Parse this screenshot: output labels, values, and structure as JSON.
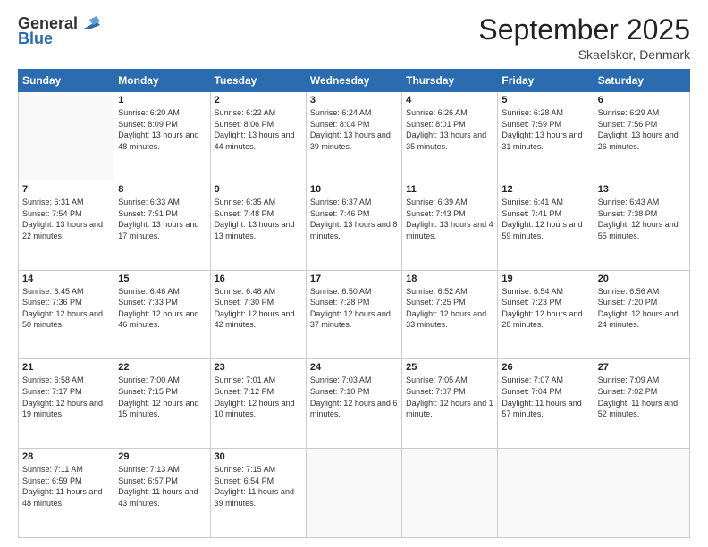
{
  "header": {
    "logo_line1": "General",
    "logo_line2": "Blue",
    "month": "September 2025",
    "location": "Skaelskor, Denmark"
  },
  "days_of_week": [
    "Sunday",
    "Monday",
    "Tuesday",
    "Wednesday",
    "Thursday",
    "Friday",
    "Saturday"
  ],
  "weeks": [
    [
      {
        "day": "",
        "sunrise": "",
        "sunset": "",
        "daylight": ""
      },
      {
        "day": "1",
        "sunrise": "6:20 AM",
        "sunset": "8:09 PM",
        "daylight": "13 hours and 48 minutes."
      },
      {
        "day": "2",
        "sunrise": "6:22 AM",
        "sunset": "8:06 PM",
        "daylight": "13 hours and 44 minutes."
      },
      {
        "day": "3",
        "sunrise": "6:24 AM",
        "sunset": "8:04 PM",
        "daylight": "13 hours and 39 minutes."
      },
      {
        "day": "4",
        "sunrise": "6:26 AM",
        "sunset": "8:01 PM",
        "daylight": "13 hours and 35 minutes."
      },
      {
        "day": "5",
        "sunrise": "6:28 AM",
        "sunset": "7:59 PM",
        "daylight": "13 hours and 31 minutes."
      },
      {
        "day": "6",
        "sunrise": "6:29 AM",
        "sunset": "7:56 PM",
        "daylight": "13 hours and 26 minutes."
      }
    ],
    [
      {
        "day": "7",
        "sunrise": "6:31 AM",
        "sunset": "7:54 PM",
        "daylight": "13 hours and 22 minutes."
      },
      {
        "day": "8",
        "sunrise": "6:33 AM",
        "sunset": "7:51 PM",
        "daylight": "13 hours and 17 minutes."
      },
      {
        "day": "9",
        "sunrise": "6:35 AM",
        "sunset": "7:48 PM",
        "daylight": "13 hours and 13 minutes."
      },
      {
        "day": "10",
        "sunrise": "6:37 AM",
        "sunset": "7:46 PM",
        "daylight": "13 hours and 8 minutes."
      },
      {
        "day": "11",
        "sunrise": "6:39 AM",
        "sunset": "7:43 PM",
        "daylight": "13 hours and 4 minutes."
      },
      {
        "day": "12",
        "sunrise": "6:41 AM",
        "sunset": "7:41 PM",
        "daylight": "12 hours and 59 minutes."
      },
      {
        "day": "13",
        "sunrise": "6:43 AM",
        "sunset": "7:38 PM",
        "daylight": "12 hours and 55 minutes."
      }
    ],
    [
      {
        "day": "14",
        "sunrise": "6:45 AM",
        "sunset": "7:36 PM",
        "daylight": "12 hours and 50 minutes."
      },
      {
        "day": "15",
        "sunrise": "6:46 AM",
        "sunset": "7:33 PM",
        "daylight": "12 hours and 46 minutes."
      },
      {
        "day": "16",
        "sunrise": "6:48 AM",
        "sunset": "7:30 PM",
        "daylight": "12 hours and 42 minutes."
      },
      {
        "day": "17",
        "sunrise": "6:50 AM",
        "sunset": "7:28 PM",
        "daylight": "12 hours and 37 minutes."
      },
      {
        "day": "18",
        "sunrise": "6:52 AM",
        "sunset": "7:25 PM",
        "daylight": "12 hours and 33 minutes."
      },
      {
        "day": "19",
        "sunrise": "6:54 AM",
        "sunset": "7:23 PM",
        "daylight": "12 hours and 28 minutes."
      },
      {
        "day": "20",
        "sunrise": "6:56 AM",
        "sunset": "7:20 PM",
        "daylight": "12 hours and 24 minutes."
      }
    ],
    [
      {
        "day": "21",
        "sunrise": "6:58 AM",
        "sunset": "7:17 PM",
        "daylight": "12 hours and 19 minutes."
      },
      {
        "day": "22",
        "sunrise": "7:00 AM",
        "sunset": "7:15 PM",
        "daylight": "12 hours and 15 minutes."
      },
      {
        "day": "23",
        "sunrise": "7:01 AM",
        "sunset": "7:12 PM",
        "daylight": "12 hours and 10 minutes."
      },
      {
        "day": "24",
        "sunrise": "7:03 AM",
        "sunset": "7:10 PM",
        "daylight": "12 hours and 6 minutes."
      },
      {
        "day": "25",
        "sunrise": "7:05 AM",
        "sunset": "7:07 PM",
        "daylight": "12 hours and 1 minute."
      },
      {
        "day": "26",
        "sunrise": "7:07 AM",
        "sunset": "7:04 PM",
        "daylight": "11 hours and 57 minutes."
      },
      {
        "day": "27",
        "sunrise": "7:09 AM",
        "sunset": "7:02 PM",
        "daylight": "11 hours and 52 minutes."
      }
    ],
    [
      {
        "day": "28",
        "sunrise": "7:11 AM",
        "sunset": "6:59 PM",
        "daylight": "11 hours and 48 minutes."
      },
      {
        "day": "29",
        "sunrise": "7:13 AM",
        "sunset": "6:57 PM",
        "daylight": "11 hours and 43 minutes."
      },
      {
        "day": "30",
        "sunrise": "7:15 AM",
        "sunset": "6:54 PM",
        "daylight": "11 hours and 39 minutes."
      },
      {
        "day": "",
        "sunrise": "",
        "sunset": "",
        "daylight": ""
      },
      {
        "day": "",
        "sunrise": "",
        "sunset": "",
        "daylight": ""
      },
      {
        "day": "",
        "sunrise": "",
        "sunset": "",
        "daylight": ""
      },
      {
        "day": "",
        "sunrise": "",
        "sunset": "",
        "daylight": ""
      }
    ]
  ]
}
